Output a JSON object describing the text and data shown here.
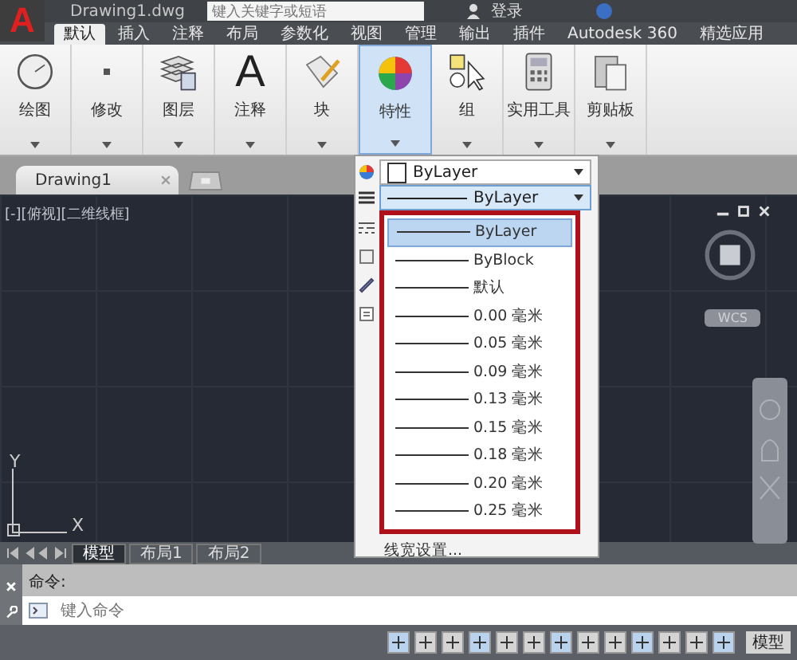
{
  "title_bar": {
    "app_button": "A",
    "title": "Drawing1.dwg",
    "search": {
      "placeholder": "键入关键字或短语"
    },
    "sign_in": "登录"
  },
  "ribbon_tabs": [
    {
      "label": "默认",
      "selected": true
    },
    {
      "label": "插入",
      "selected": false
    },
    {
      "label": "注释",
      "selected": false
    },
    {
      "label": "布局",
      "selected": false
    },
    {
      "label": "参数化",
      "selected": false
    },
    {
      "label": "视图",
      "selected": false
    },
    {
      "label": "管理",
      "selected": false
    },
    {
      "label": "输出",
      "selected": false
    },
    {
      "label": "插件",
      "selected": false
    },
    {
      "label": "Autodesk 360",
      "selected": false
    },
    {
      "label": "精选应用",
      "selected": false
    }
  ],
  "ribbon_panels": [
    {
      "label": "绘图",
      "kind": "draw",
      "selected": false
    },
    {
      "label": "修改",
      "kind": "modify",
      "selected": false
    },
    {
      "label": "图层",
      "kind": "layers",
      "selected": false
    },
    {
      "label": "注释",
      "kind": "text",
      "glyph": "A",
      "selected": false
    },
    {
      "label": "块",
      "kind": "block",
      "selected": false
    },
    {
      "label": "特性",
      "kind": "color",
      "selected": true
    },
    {
      "label": "组",
      "kind": "group",
      "selected": false
    },
    {
      "label": "实用工具",
      "kind": "calc",
      "selected": false
    },
    {
      "label": "剪贴板",
      "kind": "clipboard",
      "selected": false
    }
  ],
  "doc_tabs": [
    {
      "label": "Drawing1"
    }
  ],
  "viewport": {
    "label": "[-][俯视][二维线框]",
    "wcs": "WCS",
    "ucs_x": "X",
    "ucs_y": "Y"
  },
  "layout_tabs": [
    {
      "label": "模型",
      "selected": true
    },
    {
      "label": "布局1",
      "selected": false
    },
    {
      "label": "布局2",
      "selected": false
    }
  ],
  "command": {
    "history": "命令:",
    "placeholder": "键入命令"
  },
  "status_bar": {
    "model_button": "模型"
  },
  "properties_dropdown": {
    "color_setting": "ByLayer",
    "lineweight": "ByLayer",
    "footer": "线宽设置...",
    "options": [
      {
        "label": "ByLayer",
        "selected": true
      },
      {
        "label": "ByBlock",
        "selected": false
      },
      {
        "label": "默认",
        "selected": false
      },
      {
        "label": "0.00 毫米",
        "selected": false
      },
      {
        "label": "0.05 毫米",
        "selected": false
      },
      {
        "label": "0.09 毫米",
        "selected": false
      },
      {
        "label": "0.13 毫米",
        "selected": false
      },
      {
        "label": "0.15 毫米",
        "selected": false
      },
      {
        "label": "0.18 毫米",
        "selected": false
      },
      {
        "label": "0.20 毫米",
        "selected": false
      },
      {
        "label": "0.25 毫米",
        "selected": false
      }
    ]
  }
}
